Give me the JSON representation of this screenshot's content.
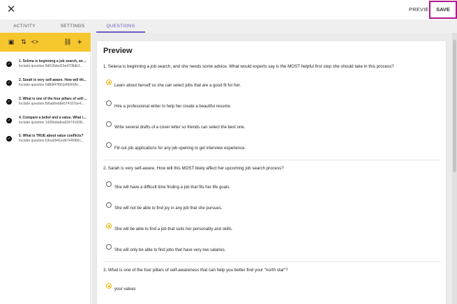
{
  "topbar": {
    "close_glyph": "✕",
    "preview_label": "PREVIEW",
    "save_label": "SAVE",
    "save_highlight_color": "#b0168f"
  },
  "tabs": [
    {
      "label": "ACTIVITY",
      "active": false
    },
    {
      "label": "SETTINGS",
      "active": false
    },
    {
      "label": "QUESTIONS",
      "active": true
    }
  ],
  "colors": {
    "accent": "#6a5fc1",
    "toolbar_yellow": "#f6c62d",
    "selected_radio": "#f2b705"
  },
  "toolbar": {
    "icons": [
      "preview-screen-icon",
      "sort-icon",
      "code-icon",
      "link-icon",
      "add-icon"
    ],
    "glyphs": [
      "▣",
      "⇅",
      "<>",
      "⛓",
      "+"
    ]
  },
  "sidebar": {
    "items": [
      {
        "title": "1. Selena is beginning a job search, and...",
        "subtitle": "Include question 8d018ded16e4708db1...",
        "check": "✓"
      },
      {
        "title": "2. Sarah is very self-aware. How will thi...",
        "subtitle": "Include question 0d8df47f0fcb49909fe...",
        "check": "✓"
      },
      {
        "title": "3. What is one of the four pillars of self-...",
        "subtitle": "Include question fb6ad6eb8e574167be4...",
        "check": "✓"
      },
      {
        "title": "4. Compare a belief and a value. What i...",
        "subtitle": "Include question 1428adadea034741838...",
        "check": "✓"
      },
      {
        "title": "5. What is TRUE about value conflicts?",
        "subtitle": "Include question b3ea9941ed6744f386c...",
        "check": "✓"
      }
    ]
  },
  "preview": {
    "title": "Preview",
    "questions": [
      {
        "text": "1. Selena is beginning a job search, and she needs some advice. What would experts say is the MOST helpful first step she should take in this process?",
        "options": [
          {
            "text": "Learn about herself so she can select jobs that are a good fit for her.",
            "selected": true
          },
          {
            "text": "Hire a professional writer to help her create a beautiful resume.",
            "selected": false
          },
          {
            "text": "Write several drafts of a cover letter so friends can select the best one.",
            "selected": false
          },
          {
            "text": "Fill out job applications for any job opening to get interview experience.",
            "selected": false
          }
        ]
      },
      {
        "text": "2. Sarah is very self-aware. How will this MOST likely affect her upcoming job search process?",
        "options": [
          {
            "text": "She will have a difficult time finding a job that fits her life goals.",
            "selected": false
          },
          {
            "text": "She will not be able to find joy in any job that she pursues.",
            "selected": false
          },
          {
            "text": "She will be able to find a job that suits her personality and skills.",
            "selected": true
          },
          {
            "text": "She will only be able to find jobs that have very low salaries.",
            "selected": false
          }
        ]
      },
      {
        "text": "3. What is one of the four pillars of self-awareness that can help you better find your \"north star\"?",
        "options": [
          {
            "text": "your values",
            "selected": true
          }
        ]
      }
    ]
  }
}
